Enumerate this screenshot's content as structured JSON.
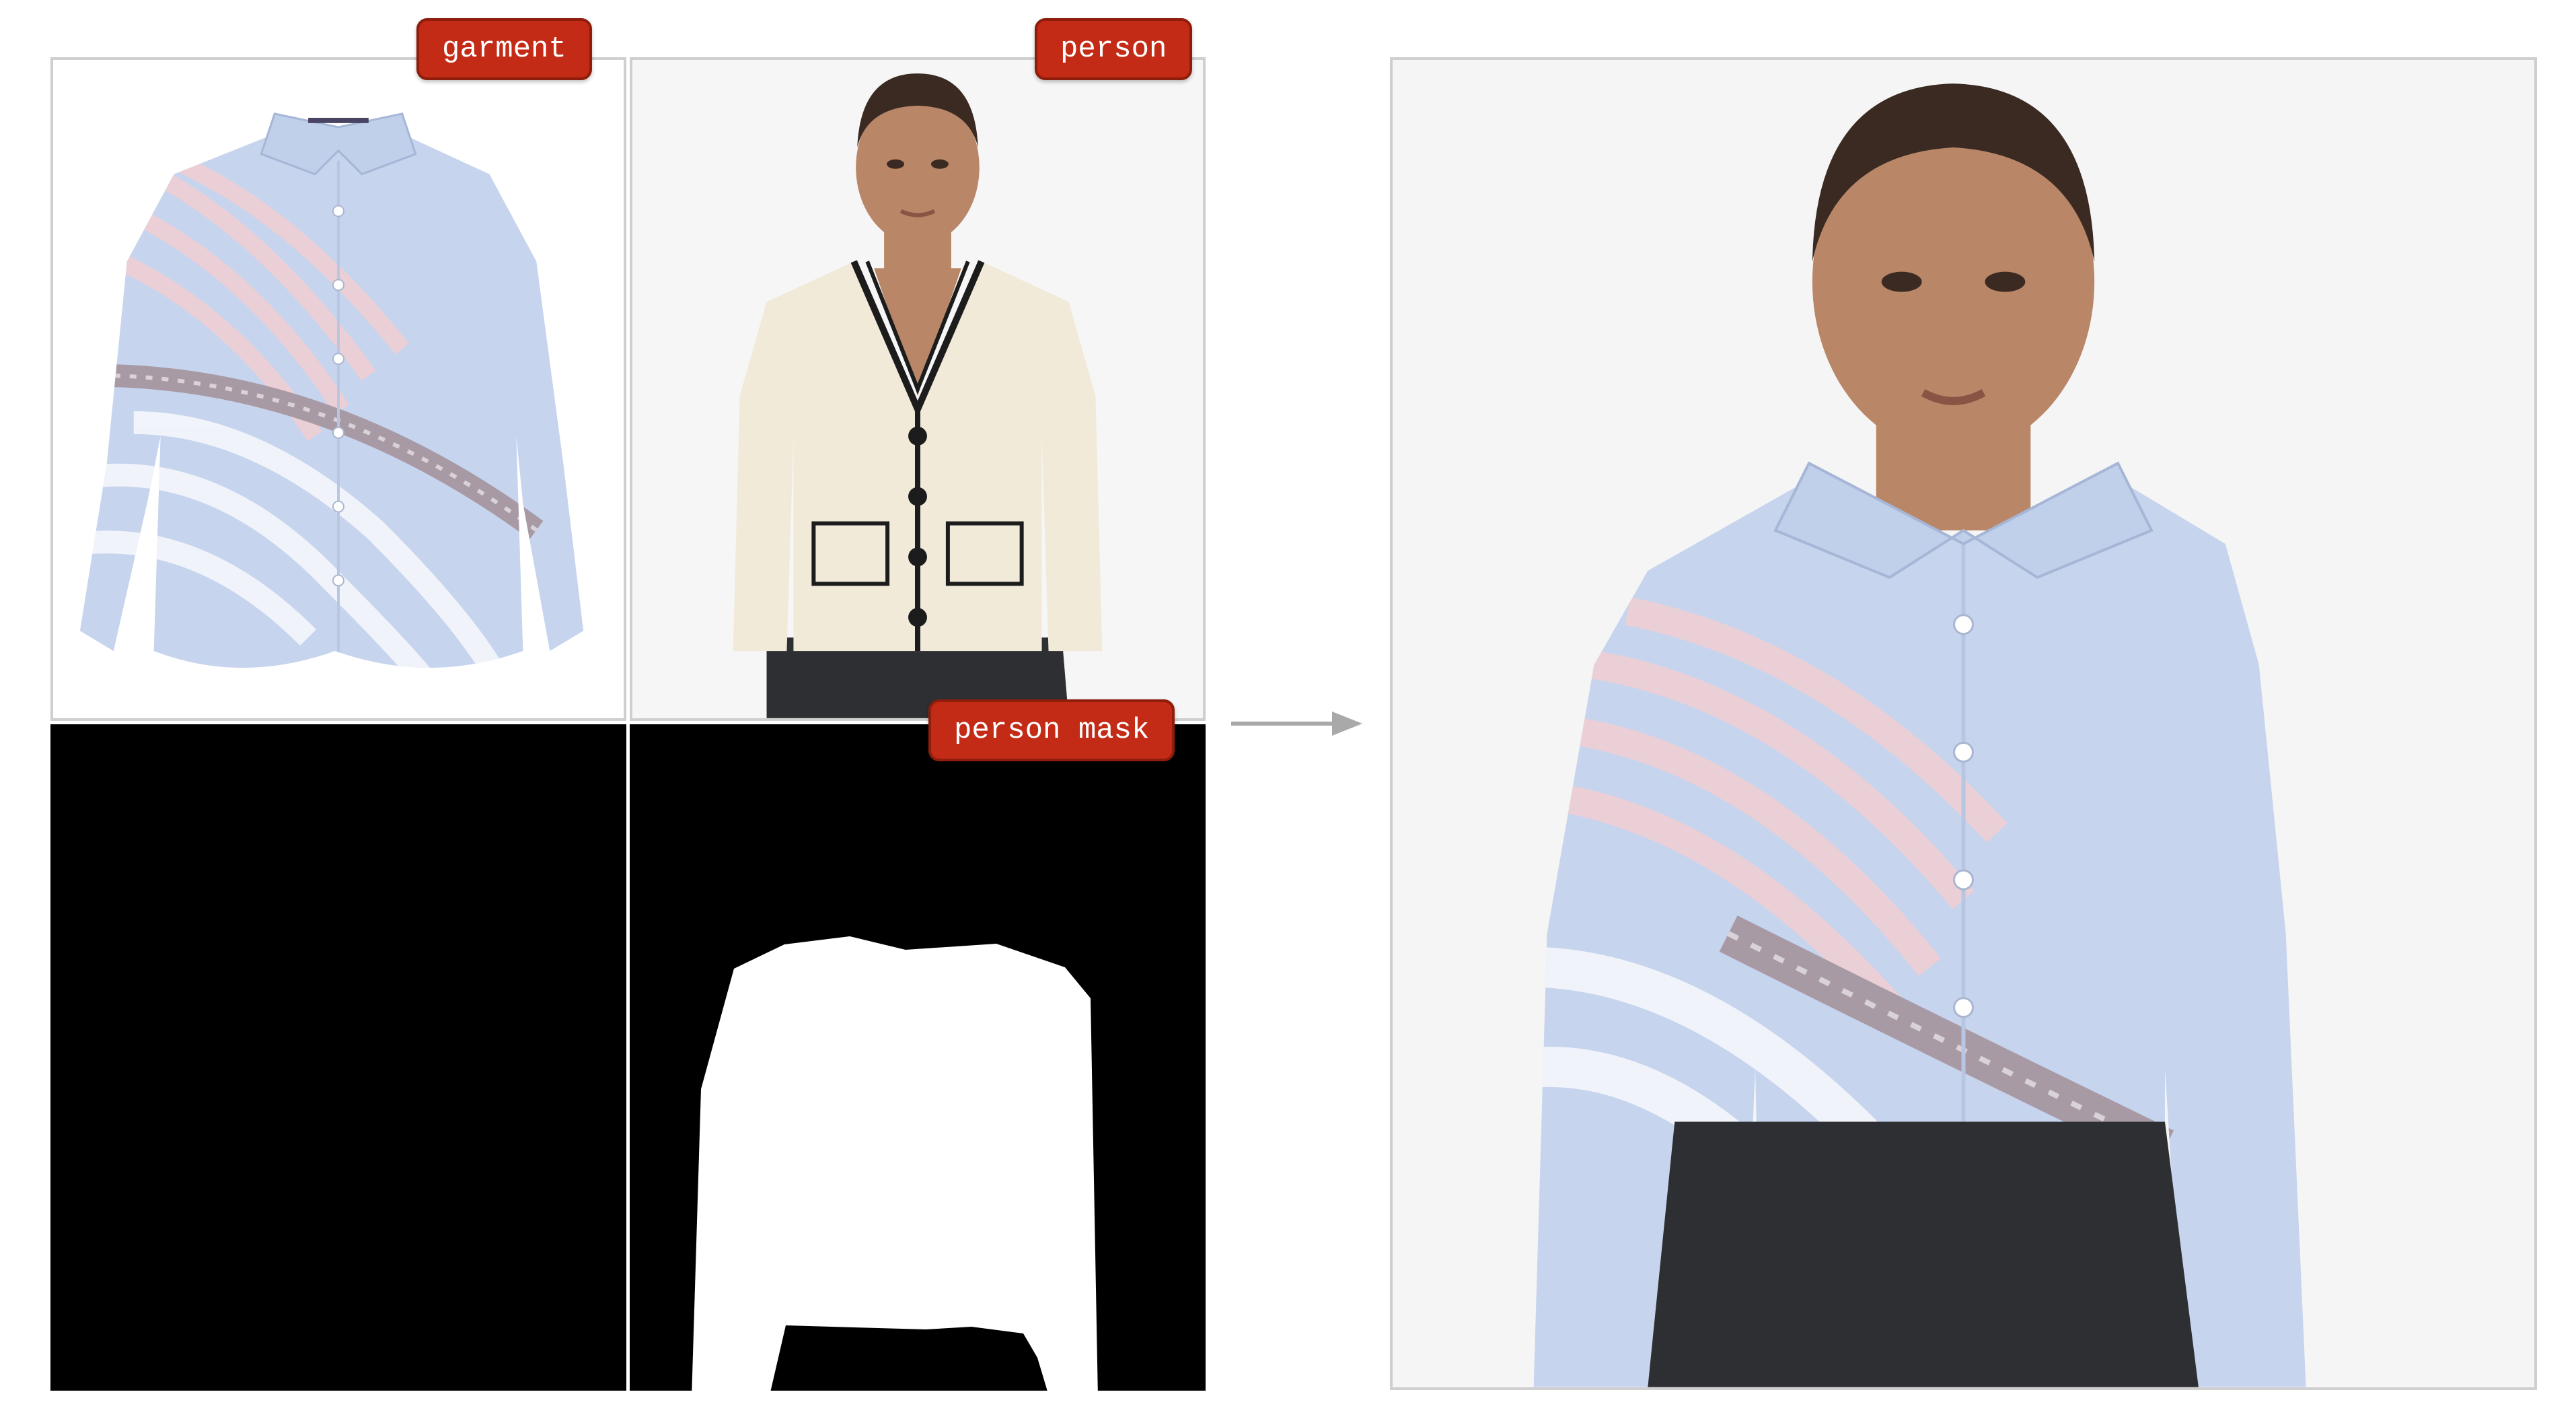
{
  "labels": {
    "garment": "garment",
    "person": "person",
    "person_mask": "person mask"
  },
  "colors": {
    "tag_fill": "#c42b16",
    "tag_border": "#8e1d0c",
    "panel_border": "#cfcfcf",
    "shirt_blue": "#c6d4ee",
    "stripe_pink": "#efcfd4",
    "stripe_white": "#f3f5fa",
    "band_mauve": "#a89aa4",
    "cardigan_cream": "#f1ead9",
    "trim_black": "#1c1c1c",
    "trousers_dark": "#2e2f33",
    "skin": "#b98668",
    "hair": "#3a2a22",
    "arrow_gray": "#a9a9a9"
  },
  "icons": {
    "arrow": "right-arrow-icon"
  }
}
